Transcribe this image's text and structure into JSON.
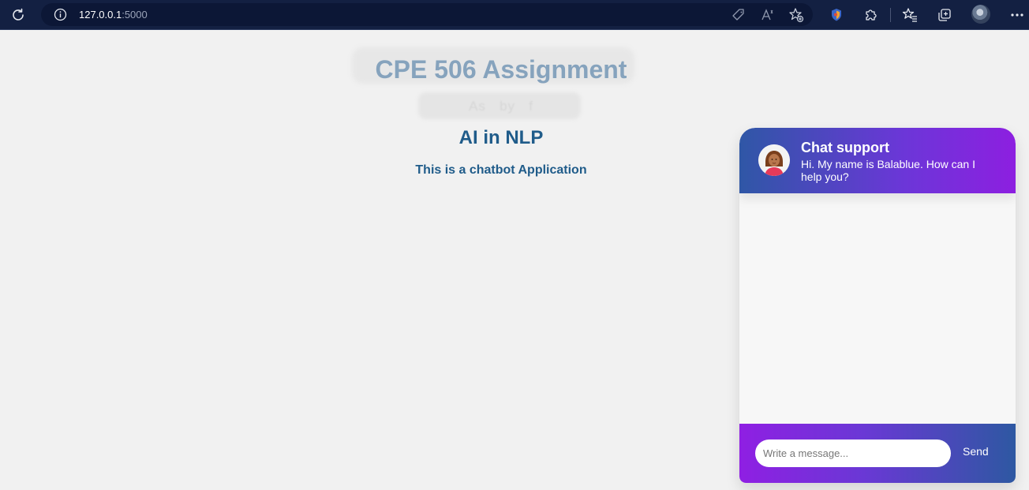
{
  "browser": {
    "url_host": "127.0.0.1",
    "url_port": ":5000"
  },
  "page": {
    "title": "CPE 506 Assignment",
    "subtitle": "As   by   f",
    "heading": "AI in NLP",
    "tagline": "This is a chatbot Application"
  },
  "chatbox": {
    "title": "Chat support",
    "description": "Hi. My name is Balablue. How can I help you?",
    "input_placeholder": "Write a message...",
    "send_label": "Send"
  },
  "colors": {
    "toolbar": "#132042",
    "title": "#86a3bd",
    "heading": "#205c8a",
    "chat_gradient_start": "#2f57a6",
    "chat_gradient_end": "#8d1fe0"
  },
  "icons": [
    "reload-icon",
    "site-info-icon",
    "price-tag-icon",
    "read-aloud-icon",
    "add-favorite-icon",
    "extension-shield-icon",
    "extensions-icon",
    "favorites-icon",
    "collections-icon",
    "profile-avatar",
    "more-icon"
  ]
}
